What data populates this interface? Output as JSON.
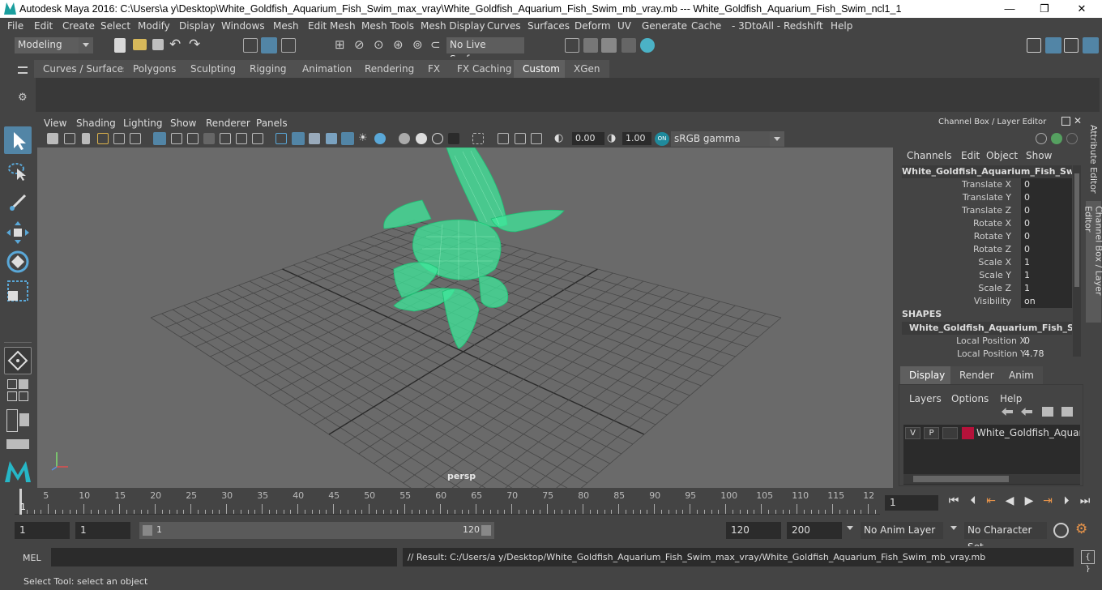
{
  "window": {
    "title": "Autodesk Maya 2016: C:\\Users\\a y\\Desktop\\White_Goldfish_Aquarium_Fish_Swim_max_vray\\White_Goldfish_Aquarium_Fish_Swim_mb_vray.mb   ---   White_Goldfish_Aquarium_Fish_Swim_ncl1_1",
    "minimize": "—",
    "maximize": "❐",
    "close": "✕"
  },
  "menubar": [
    "File",
    "Edit",
    "Create",
    "Select",
    "Modify",
    "Display",
    "Windows",
    "Mesh",
    "Edit Mesh",
    "Mesh Tools",
    "Mesh Display",
    "Curves",
    "Surfaces",
    "Deform",
    "UV",
    "Generate",
    "Cache",
    "- 3DtoAll -",
    "Redshift",
    "Help"
  ],
  "statusline": {
    "mode": "Modeling",
    "live_surface": "No Live Surface"
  },
  "shelf": {
    "tabs": [
      "Curves / Surfaces",
      "Polygons",
      "Sculpting",
      "Rigging",
      "Animation",
      "Rendering",
      "FX",
      "FX Caching",
      "Custom",
      "XGen"
    ],
    "active_tab": "Custom"
  },
  "viewport": {
    "menu": [
      "View",
      "Shading",
      "Lighting",
      "Show",
      "Renderer",
      "Panels"
    ],
    "exposure": "0.00",
    "gamma": "1.00",
    "color_space": "sRGB gamma",
    "camera_label": "persp"
  },
  "channel_box": {
    "title": "Channel Box / Layer Editor",
    "menu": [
      "Channels",
      "Edit",
      "Object",
      "Show"
    ],
    "object_name": "White_Goldfish_Aquarium_Fish_Swim...",
    "attributes": [
      {
        "label": "Translate X",
        "value": "0"
      },
      {
        "label": "Translate Y",
        "value": "0"
      },
      {
        "label": "Translate Z",
        "value": "0"
      },
      {
        "label": "Rotate X",
        "value": "0"
      },
      {
        "label": "Rotate Y",
        "value": "0"
      },
      {
        "label": "Rotate Z",
        "value": "0"
      },
      {
        "label": "Scale X",
        "value": "1"
      },
      {
        "label": "Scale Y",
        "value": "1"
      },
      {
        "label": "Scale Z",
        "value": "1"
      },
      {
        "label": "Visibility",
        "value": "on"
      }
    ],
    "shapes_header": "SHAPES",
    "shape_name": "White_Goldfish_Aquarium_Fish_Swi...",
    "shape_attributes": [
      {
        "label": "Local Position X",
        "value": "0"
      },
      {
        "label": "Local Position Y",
        "value": "4.78"
      }
    ]
  },
  "side_tabs": [
    "Attribute Editor",
    "Channel Box / Layer Editor"
  ],
  "layer_editor": {
    "tabs": [
      "Display",
      "Render",
      "Anim"
    ],
    "active_tab": "Display",
    "menu": [
      "Layers",
      "Options",
      "Help"
    ],
    "layer": {
      "v": "V",
      "p": "P",
      "name": "White_Goldfish_Aquariu",
      "color": "#b5123a"
    }
  },
  "timeline": {
    "ticks": [
      "5",
      "10",
      "15",
      "20",
      "25",
      "30",
      "35",
      "40",
      "45",
      "50",
      "55",
      "60",
      "65",
      "70",
      "75",
      "80",
      "85",
      "90",
      "95",
      "100",
      "105",
      "110",
      "115",
      "12"
    ],
    "current_frame_marker": "1",
    "current_frame": "1"
  },
  "range": {
    "start": "1",
    "playback_start": "1",
    "slider_start": "1",
    "slider_end": "120",
    "playback_end": "120",
    "end": "200",
    "anim_layer": "No Anim Layer",
    "character_set": "No Character Set"
  },
  "command": {
    "label": "MEL",
    "result": "// Result: C:/Users/a y/Desktop/White_Goldfish_Aquarium_Fish_Swim_max_vray/White_Goldfish_Aquarium_Fish_Swim_mb_vray.mb"
  },
  "help_line": "Select Tool: select an object",
  "colors": {
    "accent": "#5285a6",
    "wireframe": "#3fe89b",
    "panel": "#444444",
    "field": "#2b2b2b"
  }
}
